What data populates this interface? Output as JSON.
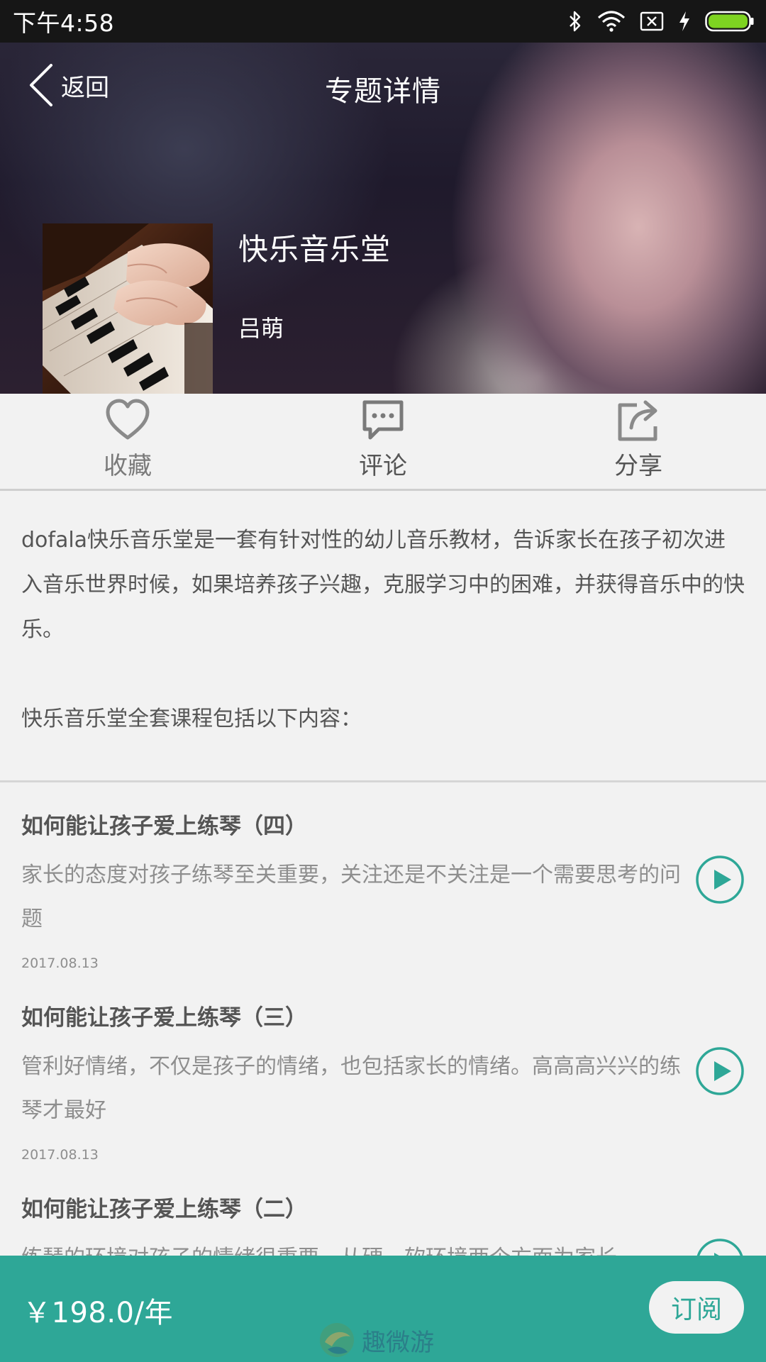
{
  "status_bar": {
    "time": "下午4:58",
    "icons": [
      "bluetooth-icon",
      "wifi-icon",
      "no-sim-icon",
      "charging-icon",
      "battery-icon"
    ],
    "battery_color": "#7ed321"
  },
  "header": {
    "back_label": "返回",
    "title": "专题详情"
  },
  "album": {
    "title": "快乐音乐堂",
    "author": "吕萌"
  },
  "actions": [
    {
      "label": "收藏",
      "icon": "heart-icon"
    },
    {
      "label": "评论",
      "icon": "comment-icon"
    },
    {
      "label": "分享",
      "icon": "share-icon"
    }
  ],
  "description": {
    "paragraph1": "dofala快乐音乐堂是一套有针对性的幼儿音乐教材，告诉家长在孩子初次进入音乐世界时候，如果培养孩子兴趣，克服学习中的困难，并获得音乐中的快乐。",
    "paragraph2": "快乐音乐堂全套课程包括以下内容："
  },
  "episodes": [
    {
      "title": "如何能让孩子爱上练琴（四）",
      "summary": "家长的态度对孩子练琴至关重要，关注还是不关注是一个需要思考的问题",
      "date": "2017.08.13"
    },
    {
      "title": "如何能让孩子爱上练琴（三）",
      "summary": "管利好情绪，不仅是孩子的情绪，也包括家长的情绪。高高高兴兴的练琴才最好",
      "date": "2017.08.13"
    },
    {
      "title": "如何能让孩子爱上练琴（二）",
      "summary": "练琴的环境对孩子的情绪很重要，从硬、软环境两个方面为家长",
      "date": ""
    }
  ],
  "bottom_bar": {
    "price": "￥198.0/年",
    "subscribe_label": "订阅",
    "watermark_text": "趣微游",
    "accent_color": "#2ea797"
  }
}
